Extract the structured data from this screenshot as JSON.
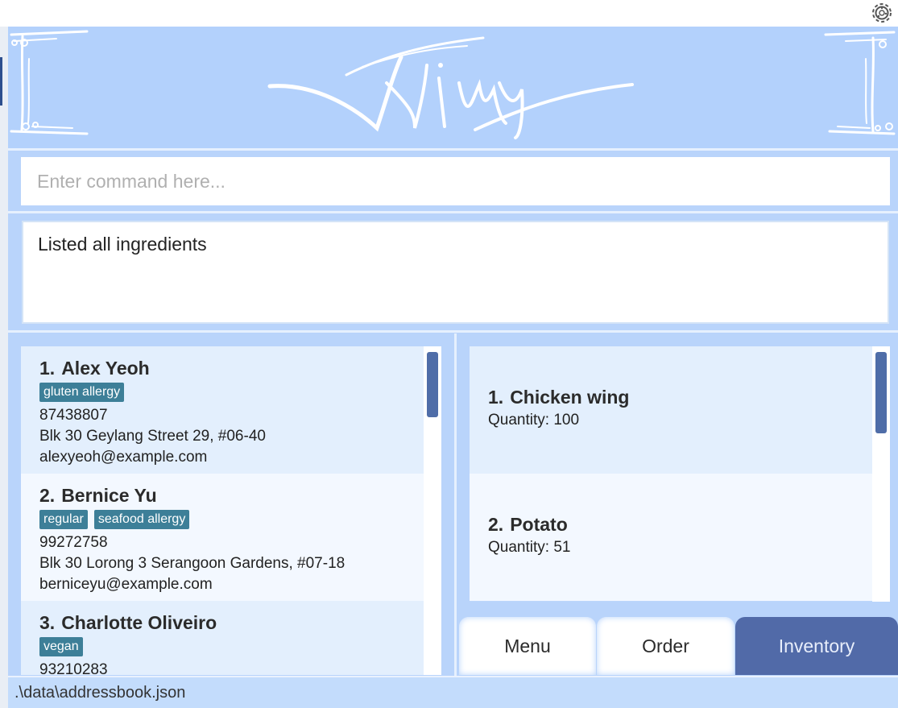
{
  "app": {
    "logo_text": "Jimy",
    "command_box": {
      "placeholder": "Enter command here..."
    },
    "result_message": "Listed all ingredients",
    "status_bar_path": ".\\data\\addressbook.json"
  },
  "persons": [
    {
      "index": "1.",
      "name": "Alex Yeoh",
      "tags": [
        "gluten allergy"
      ],
      "phone": "87438807",
      "address": "Blk 30 Geylang Street 29, #06-40",
      "email": "alexyeoh@example.com"
    },
    {
      "index": "2.",
      "name": "Bernice Yu",
      "tags": [
        "regular",
        "seafood allergy"
      ],
      "phone": "99272758",
      "address": "Blk 30 Lorong 3 Serangoon Gardens, #07-18",
      "email": "berniceyu@example.com"
    },
    {
      "index": "3.",
      "name": "Charlotte Oliveiro",
      "tags": [
        "vegan"
      ],
      "phone": "93210283",
      "address": "",
      "email": ""
    }
  ],
  "ingredients": [
    {
      "index": "1.",
      "name": "Chicken wing",
      "quantity": "Quantity: 100"
    },
    {
      "index": "2.",
      "name": "Potato",
      "quantity": "Quantity: 51"
    }
  ],
  "tabs": [
    {
      "label": "Menu",
      "active": false
    },
    {
      "label": "Order",
      "active": false
    },
    {
      "label": "Inventory",
      "active": true
    }
  ],
  "icons": {
    "settings": "gear-icon",
    "logo": "jimy-logo"
  },
  "colors": {
    "accent": "#516aa8",
    "tag": "#3d7f98",
    "background": "#b9d4fb"
  }
}
